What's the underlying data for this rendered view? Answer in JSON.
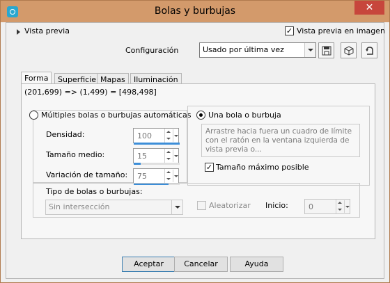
{
  "window": {
    "title": "Bolas y burbujas",
    "close_label": "✕"
  },
  "header": {
    "preview_label": "Vista previa",
    "preview_in_image_label": "Vista previa en imagen",
    "preview_in_image_checked": true,
    "config_label": "Configuración",
    "config_value": "Usado por última vez",
    "icons": [
      "save-icon",
      "cube-icon",
      "reset-icon"
    ]
  },
  "tabs": [
    {
      "label": "Forma",
      "active": true
    },
    {
      "label": "Superficie",
      "active": false
    },
    {
      "label": "Mapas",
      "active": false
    },
    {
      "label": "Iluminación",
      "active": false
    }
  ],
  "coords_text": "(201,699) => (1,499) = [498,498]",
  "auto": {
    "label": "Múltiples bolas o burbujas automáticas",
    "selected": false,
    "density_label": "Densidad:",
    "density_value": "100",
    "density_fraction": 1.0,
    "size_label": "Tamaño medio:",
    "size_value": "15",
    "size_fraction": 0.15,
    "variation_label": "Variación de tamaño:",
    "variation_value": "75",
    "variation_fraction": 0.75,
    "type_label": "Tipo de bolas o burbujas:",
    "type_value": "Sin intersección",
    "random_label": "Aleatorizar",
    "start_label": "Inicio:",
    "start_value": "0"
  },
  "single": {
    "label": "Una bola o burbuja",
    "selected": true,
    "hint": "Arrastre hacia fuera un cuadro de límite con el ratón en la ventana izquierda de vista previa o...",
    "max_size_label": "Tamaño máximo posible",
    "max_size_checked": true
  },
  "buttons": {
    "ok": "Aceptar",
    "cancel": "Cancelar",
    "help": "Ayuda"
  },
  "colors": {
    "titlebar": "#d39a6b",
    "close": "#c7463c",
    "accent": "#3c8ed8"
  }
}
